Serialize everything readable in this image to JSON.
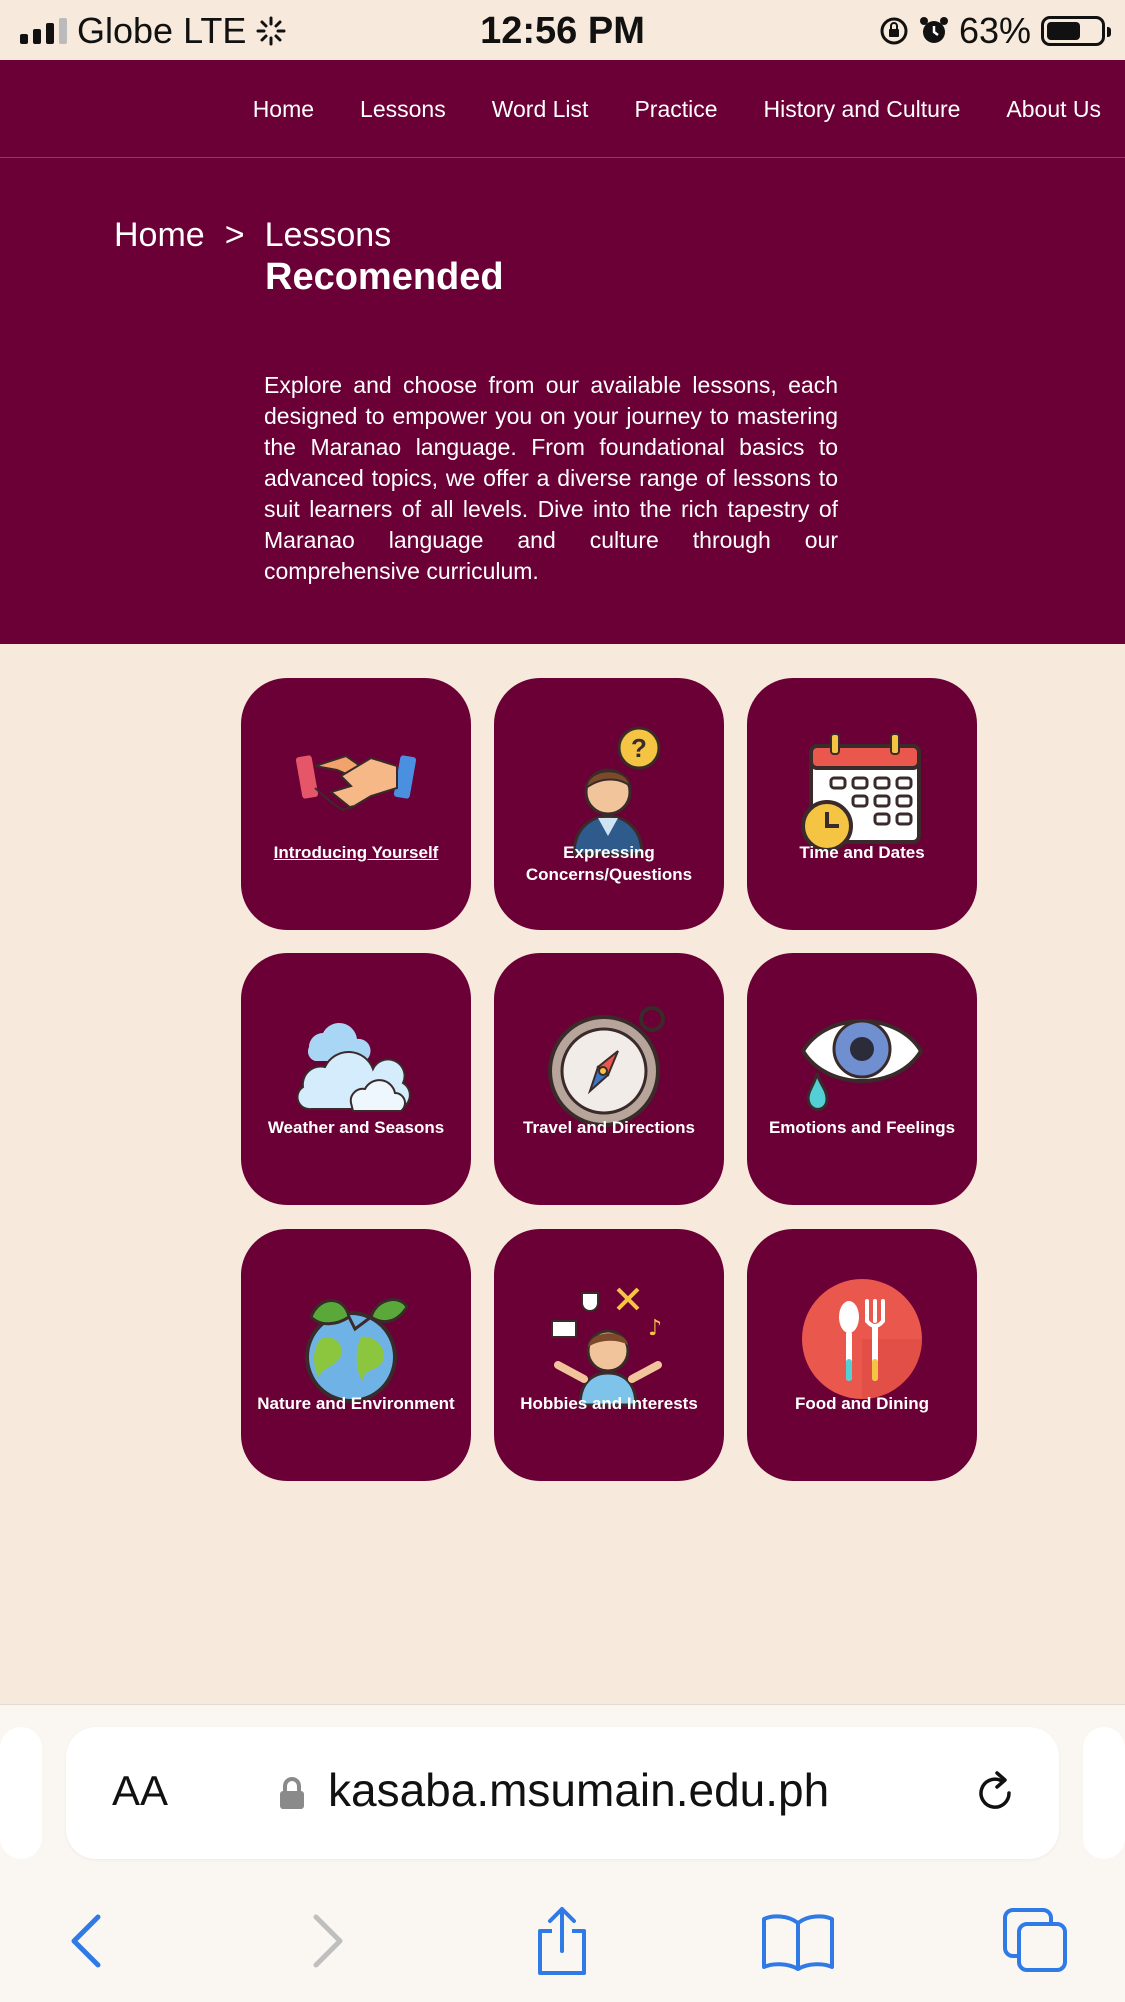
{
  "status_bar": {
    "carrier": "Globe",
    "network": "LTE",
    "time": "12:56 PM",
    "battery": "63%",
    "battery_level": 0.63
  },
  "nav": {
    "items": [
      "Home",
      "Lessons",
      "Word List",
      "Practice",
      "History and Culture",
      "About Us"
    ]
  },
  "breadcrumb": {
    "home": "Home",
    "separator": ">",
    "current": "Lessons"
  },
  "hero": {
    "title": "Recomended",
    "description": "Explore and choose from our available lessons, each designed to empower you on your journey to mastering the Maranao language. From foundational basics to advanced topics, we offer a diverse range of lessons to suit learners of all levels. Dive into the rich tapestry of Maranao language and culture through our comprehensive curriculum."
  },
  "lessons": [
    {
      "label": "Introducing Yourself",
      "icon": "handshake-icon"
    },
    {
      "label": "Expressing Concerns/Questions",
      "icon": "question-person-icon"
    },
    {
      "label": "Time and Dates",
      "icon": "calendar-clock-icon"
    },
    {
      "label": "Weather and Seasons",
      "icon": "clouds-icon"
    },
    {
      "label": "Travel and Directions",
      "icon": "compass-icon"
    },
    {
      "label": "Emotions and Feelings",
      "icon": "crying-eye-icon"
    },
    {
      "label": "Nature and Environment",
      "icon": "earth-leaves-icon"
    },
    {
      "label": "Hobbies and Interests",
      "icon": "hobbies-person-icon"
    },
    {
      "label": "Food and Dining",
      "icon": "spoon-fork-icon"
    }
  ],
  "browser": {
    "text_size_label": "AA",
    "url": "kasaba.msumain.edu.ph"
  },
  "colors": {
    "brand": "#6a0036",
    "background": "#f7e9db",
    "browser_accent": "#2f7ae5"
  }
}
